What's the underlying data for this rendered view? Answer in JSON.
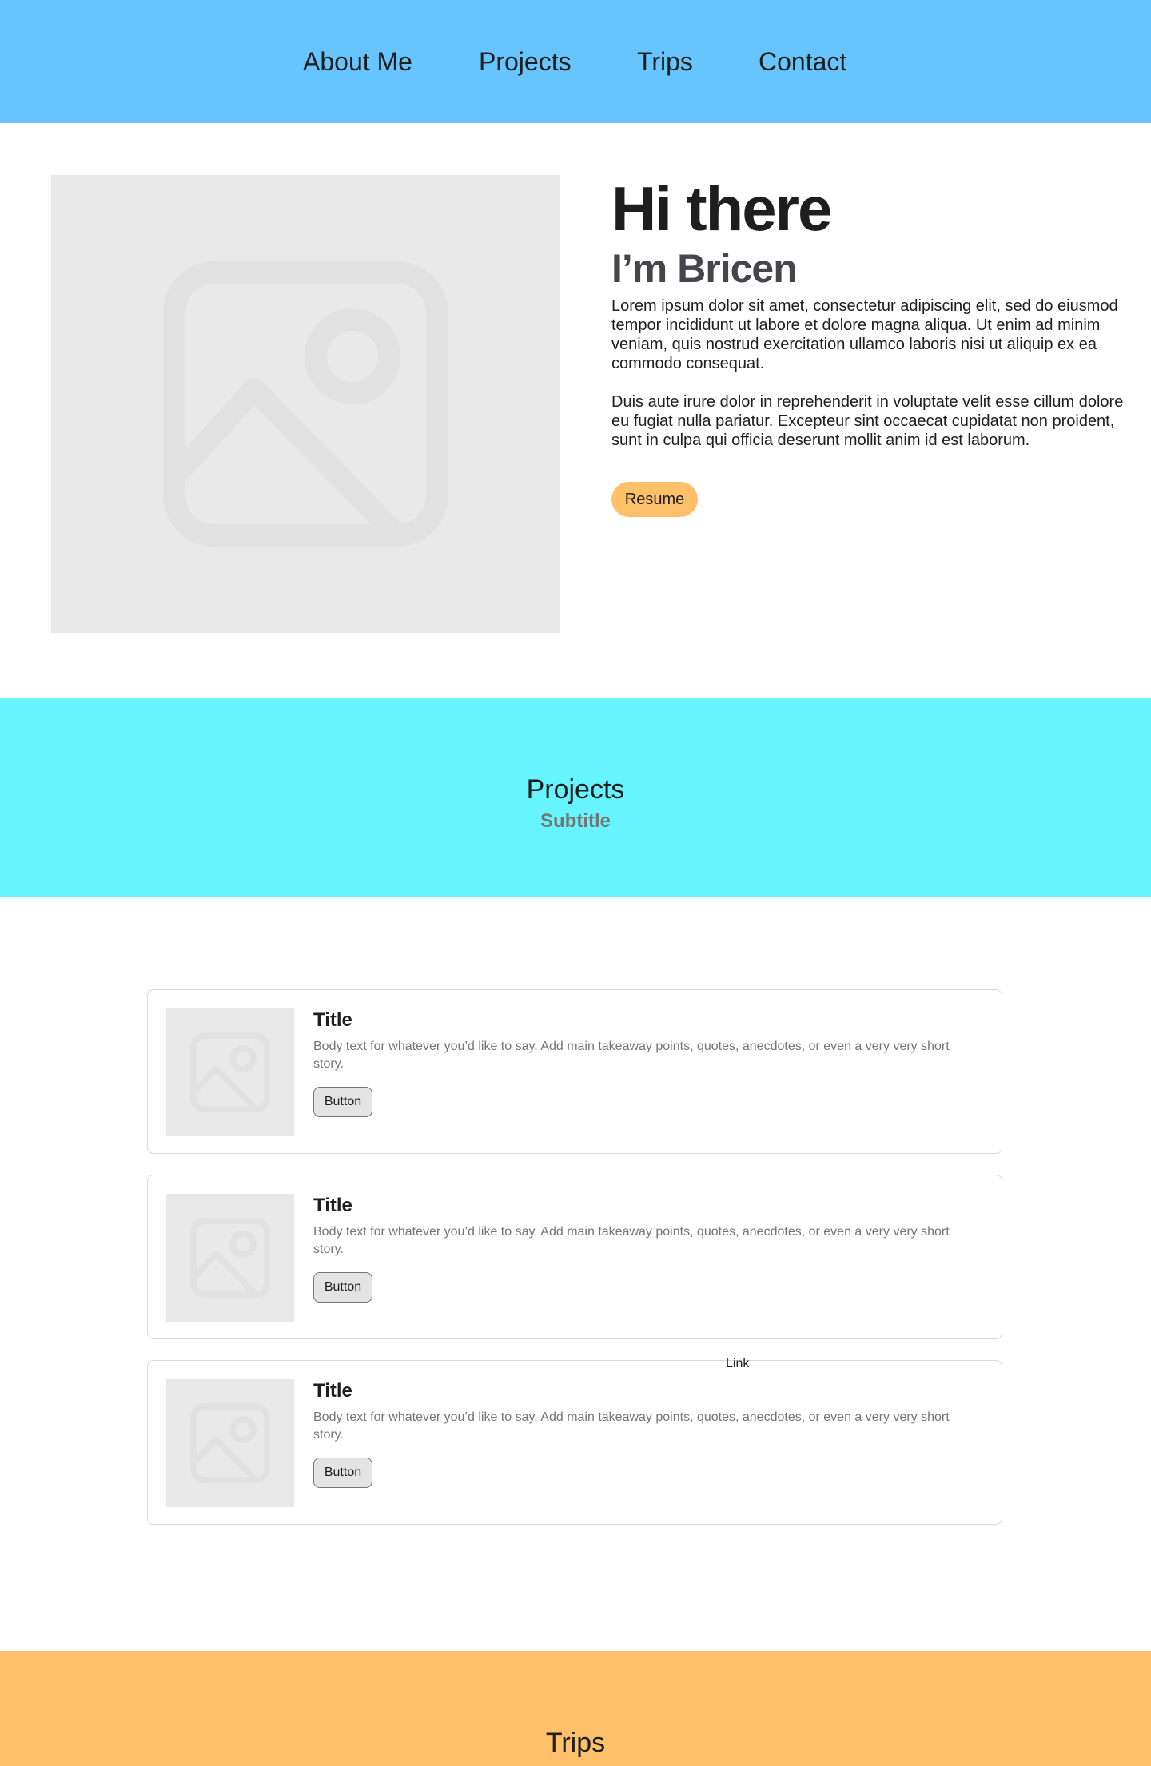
{
  "nav": {
    "items": [
      {
        "label": "About Me"
      },
      {
        "label": "Projects"
      },
      {
        "label": "Trips"
      },
      {
        "label": "Contact"
      }
    ],
    "background": "#66c4ff"
  },
  "hero": {
    "image_icon": "image-placeholder-icon",
    "title": "Hi there",
    "subtitle": "I’m Bricen",
    "paragraph_1": "Lorem ipsum dolor sit amet, consectetur adipiscing elit, sed do eiusmod tempor incididunt ut labore et dolore magna aliqua. Ut enim ad minim veniam, quis nostrud exercitation ullamco laboris nisi ut aliquip ex ea commodo consequat.",
    "paragraph_2": "Duis aute irure dolor in reprehenderit in voluptate velit esse cillum dolore eu fugiat nulla pariatur. Excepteur sint occaecat cupidatat non proident, sunt in culpa qui officia deserunt mollit anim id est laborum.",
    "button_label": "Resume",
    "button_color": "#ffc06a"
  },
  "projects_section": {
    "title": "Projects",
    "subtitle": "Subtitle",
    "background": "#66f5ff"
  },
  "cards": [
    {
      "title": "Title",
      "body": "Body text for whatever you’d like to say. Add main takeaway points, quotes, anecdotes, or even a very very short story.",
      "button_label": "Button"
    },
    {
      "title": "Title",
      "body": "Body text for whatever you’d like to say. Add main takeaway points, quotes, anecdotes, or even a very very short story.",
      "button_label": "Button"
    },
    {
      "title": "Title",
      "body": "Body text for whatever you’d like to say. Add main takeaway points, quotes, anecdotes, or even a very very short story.",
      "button_label": "Button"
    }
  ],
  "link_label": "Link",
  "trips_section": {
    "title": "Trips",
    "background": "#ffc06a"
  }
}
